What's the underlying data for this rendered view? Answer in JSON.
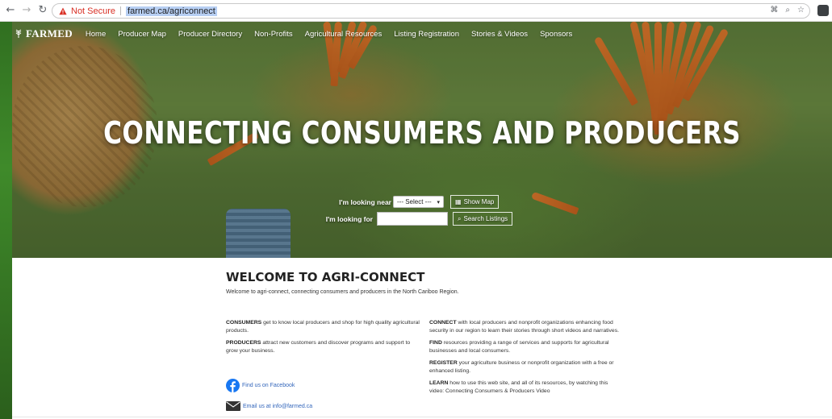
{
  "browser": {
    "security_label": "Not Secure",
    "url": "farmed.ca/agriconnect"
  },
  "site": {
    "logo_text": "FARMED",
    "nav": [
      "Home",
      "Producer Map",
      "Producer Directory",
      "Non-Profits",
      "Agricultural Resources",
      "Listing Registration",
      "Stories & Videos",
      "Sponsors"
    ]
  },
  "hero": {
    "title": "CONNECTING CONSUMERS AND PRODUCERS",
    "near_label": "I'm looking near",
    "near_select_value": "--- Select ---",
    "show_map_button": "Show Map",
    "for_label": "I'm looking for",
    "search_placeholder": "",
    "search_button": "Search Listings"
  },
  "welcome": {
    "title": "WELCOME TO AGRI-CONNECT",
    "subtitle": "Welcome to agri-connect, connecting consumers and producers in the North Cariboo Region."
  },
  "left_column": [
    {
      "lead": "CONSUMERS",
      "text": " get to know local producers and shop for high quality agricultural products."
    },
    {
      "lead": "PRODUCERS",
      "text": " attract new customers and discover programs and support to grow your business."
    }
  ],
  "right_column": [
    {
      "lead": "CONNECT",
      "text": " with local producers and nonprofit organizations enhancing food security in our region to learn their stories through short videos and narratives."
    },
    {
      "lead": "FIND",
      "text": " resources providing a range of services and supports for agricultural businesses and local consumers."
    },
    {
      "lead": "REGISTER",
      "text": " your agriculture business or nonprofit organization with a free or enhanced listing."
    },
    {
      "lead": "LEARN",
      "text": " how to use this web site, and all of its resources, by watching this video: Connecting Consumers & Producers Video"
    }
  ],
  "social": {
    "facebook": "Find us on Facebook",
    "email": "Email us at info@farmed.ca"
  },
  "colors": {
    "link": "#3366bb",
    "facebook": "#1877f2",
    "not_secure": "#d93025"
  },
  "icons": [
    "back-arrow-icon",
    "forward-arrow-icon",
    "reload-icon",
    "warning-icon",
    "key-icon",
    "zoom-icon",
    "star-icon",
    "profile-icon",
    "wheat-logo-icon",
    "map-icon",
    "search-icon",
    "facebook-icon",
    "envelope-icon"
  ]
}
